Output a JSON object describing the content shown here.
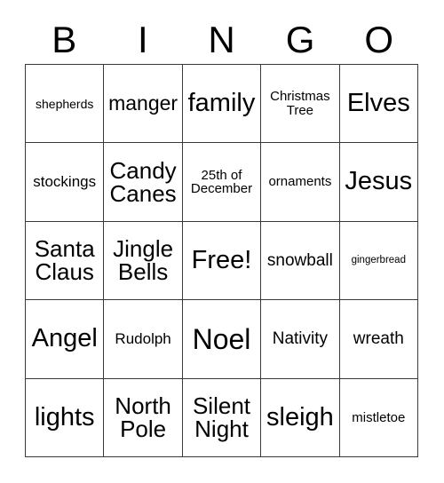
{
  "card": {
    "title": "BINGO",
    "header_letters": [
      "B",
      "I",
      "N",
      "G",
      "O"
    ],
    "grid_size": "5x5",
    "border_color": "#3a3a3a",
    "background_color": "#ffffff",
    "text_color": "#000000",
    "free_space": "Free!",
    "cells": [
      [
        {
          "text": "shepherds",
          "size": "s"
        },
        {
          "text": "manger",
          "size": "l"
        },
        {
          "text": "family",
          "size": "xxl"
        },
        {
          "text": "Christmas\nTree",
          "size": "sm"
        },
        {
          "text": "Elves",
          "size": "xxl"
        }
      ],
      [
        {
          "text": "stockings",
          "size": "m"
        },
        {
          "text": "Candy\nCanes",
          "size": "xl"
        },
        {
          "text": "25th of\nDecember",
          "size": "sm"
        },
        {
          "text": "ornaments",
          "size": "sm"
        },
        {
          "text": "Jesus",
          "size": "xxl"
        }
      ],
      [
        {
          "text": "Santa\nClaus",
          "size": "xl"
        },
        {
          "text": "Jingle\nBells",
          "size": "xl"
        },
        {
          "text": "Free!",
          "size": "xxl"
        },
        {
          "text": "snowball",
          "size": "ml"
        },
        {
          "text": "gingerbread",
          "size": "xs"
        }
      ],
      [
        {
          "text": "Angel",
          "size": "xxl"
        },
        {
          "text": "Rudolph",
          "size": "m"
        },
        {
          "text": "Noel",
          "size": "xxxl"
        },
        {
          "text": "Nativity",
          "size": "ml"
        },
        {
          "text": "wreath",
          "size": "ml"
        }
      ],
      [
        {
          "text": "lights",
          "size": "xxl"
        },
        {
          "text": "North\nPole",
          "size": "xl"
        },
        {
          "text": "Silent\nNight",
          "size": "xl"
        },
        {
          "text": "sleigh",
          "size": "xxl"
        },
        {
          "text": "mistletoe",
          "size": "sm"
        }
      ]
    ]
  }
}
